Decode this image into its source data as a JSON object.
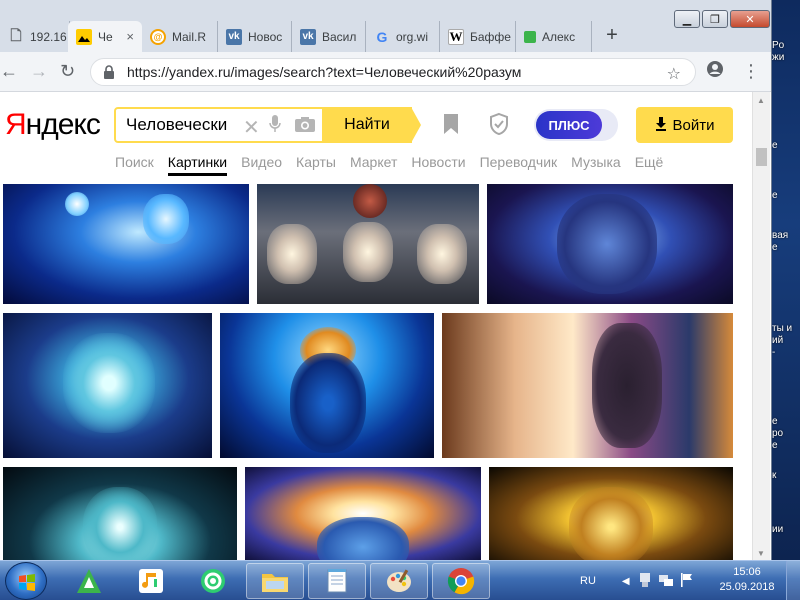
{
  "browser": {
    "tabs": [
      {
        "title": "192.16",
        "favicon": "page-icon",
        "active": false
      },
      {
        "title": "Че",
        "favicon": "yandex-images-icon",
        "active": true
      },
      {
        "title": "Mail.R",
        "favicon": "mail-ru-icon",
        "active": false
      },
      {
        "title": "Новос",
        "favicon": "vk-icon",
        "active": false
      },
      {
        "title": "Васил",
        "favicon": "vk-icon",
        "active": false
      },
      {
        "title": "org.wi",
        "favicon": "google-icon",
        "active": false
      },
      {
        "title": "Баффе",
        "favicon": "wikipedia-icon",
        "active": false
      },
      {
        "title": "Алекс",
        "favicon": "green-square-icon",
        "active": false
      }
    ],
    "close_glyph": "×",
    "new_tab_glyph": "+",
    "url": "https://yandex.ru/images/search?text=Человеческий%20разум"
  },
  "yandex": {
    "logo_first": "Я",
    "logo_rest": "ндекс",
    "search_query": "Человечески",
    "find_label": "Найти",
    "plus_label": "ПЛЮС",
    "login_label": "Войти",
    "services": [
      {
        "label": "Поиск",
        "active": false
      },
      {
        "label": "Картинки",
        "active": true
      },
      {
        "label": "Видео",
        "active": false
      },
      {
        "label": "Карты",
        "active": false
      },
      {
        "label": "Маркет",
        "active": false
      },
      {
        "label": "Новости",
        "active": false
      },
      {
        "label": "Переводчик",
        "active": false
      },
      {
        "label": "Музыка",
        "active": false
      },
      {
        "label": "Ещё",
        "active": false
      }
    ]
  },
  "desktop_fragments": [
    "Po\nжи",
    "е",
    "е",
    "вая\nе",
    "ты и\nий\n-",
    "е\nро\nе",
    "к",
    "ии"
  ],
  "taskbar": {
    "language": "RU",
    "time": "15:06",
    "date": "25.09.2018"
  },
  "colors": {
    "yandex_yellow": "#ffdb4d",
    "yandex_red": "#ff0000",
    "plus_blue": "#2a34c8"
  }
}
